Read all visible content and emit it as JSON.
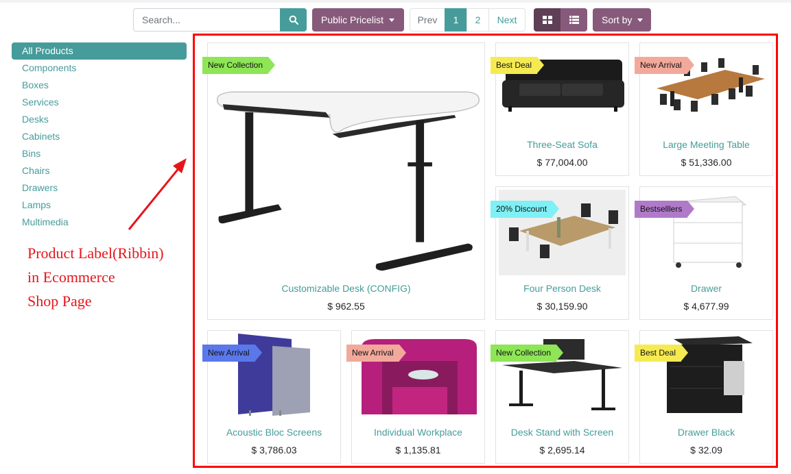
{
  "search": {
    "placeholder": "Search..."
  },
  "pricelist": {
    "label": "Public Pricelist"
  },
  "pager": {
    "prev": "Prev",
    "pages": [
      "1",
      "2"
    ],
    "next": "Next"
  },
  "sort": {
    "label": "Sort by"
  },
  "categories": [
    "All Products",
    "Components",
    "Boxes",
    "Services",
    "Desks",
    "Cabinets",
    "Bins",
    "Chairs",
    "Drawers",
    "Lamps",
    "Multimedia"
  ],
  "annotation": [
    "Product Label(Ribbin)",
    "in Ecommerce",
    "Shop Page"
  ],
  "products": [
    {
      "name": "Customizable Desk (CONFIG)",
      "price": "$ 962.55",
      "ribbon": "New Collection",
      "ribbon_color": "#8ee556",
      "image": "desk-image"
    },
    {
      "name": "Three-Seat Sofa",
      "price": "$ 77,004.00",
      "ribbon": "Best Deal",
      "ribbon_color": "#f6ea52",
      "image": "sofa-image"
    },
    {
      "name": "Large Meeting Table",
      "price": "$ 51,336.00",
      "ribbon": "New Arrival",
      "ribbon_color": "#f2a99b",
      "image": "meeting-table-image"
    },
    {
      "name": "Four Person Desk",
      "price": "$ 30,159.90",
      "ribbon": "20% Discount",
      "ribbon_color": "#7ff0f5",
      "image": "four-person-desk-image"
    },
    {
      "name": "Drawer",
      "price": "$ 4,677.99",
      "ribbon": "Bestselllers",
      "ribbon_color": "#b07ac9",
      "image": "drawer-image"
    },
    {
      "name": "Acoustic Bloc Screens",
      "price": "$ 3,786.03",
      "ribbon": "New Arrival",
      "ribbon_color": "#5a78ea",
      "image": "screens-image"
    },
    {
      "name": "Individual Workplace",
      "price": "$ 1,135.81",
      "ribbon": "New Arrival",
      "ribbon_color": "#f2a99b",
      "image": "workplace-image"
    },
    {
      "name": "Desk Stand with Screen",
      "price": "$ 2,695.14",
      "ribbon": "New Collection",
      "ribbon_color": "#8ee556",
      "image": "desk-stand-image"
    },
    {
      "name": "Drawer Black",
      "price": "$ 32.09",
      "ribbon": "Best Deal",
      "ribbon_color": "#f6ea52",
      "image": "drawer-black-image"
    }
  ]
}
